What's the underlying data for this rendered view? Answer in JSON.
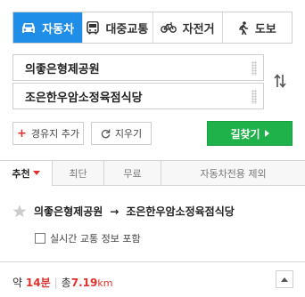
{
  "modes": {
    "car": {
      "label": "자동차",
      "icon": "car-icon"
    },
    "transit": {
      "label": "대중교통",
      "icon": "bus-icon"
    },
    "bike": {
      "label": "자전거",
      "icon": "bicycle-icon"
    },
    "walk": {
      "label": "도보",
      "icon": "walking-icon"
    },
    "active": "car"
  },
  "inputs": {
    "origin": "의좋은형제공원",
    "destination": "조은한우암소정육점식당"
  },
  "buttons": {
    "add_waypoint": "경유지 추가",
    "clear": "지우기",
    "search": "길찾기"
  },
  "options": {
    "recommended": "추천",
    "shortest": "최단",
    "free": "무료",
    "no_expressway": "자동차전용 제외"
  },
  "route": {
    "from": "의좋은형제공원",
    "arrow": "→",
    "to": "조은한우암소정육점식당"
  },
  "realtime_label": "실시간 교통 정보 포함",
  "summary": {
    "approx": "약",
    "time": "14분",
    "total_label": "총",
    "distance_value": "7.19",
    "distance_unit": "km"
  },
  "colors": {
    "accent_blue": "#1f8ee8",
    "search_green": "#1fb24a",
    "highlight_red": "#e0312c"
  }
}
